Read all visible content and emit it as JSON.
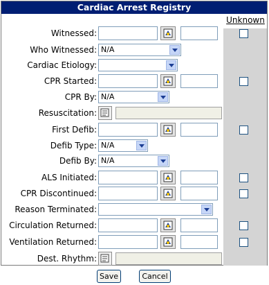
{
  "form": {
    "title": "Cardiac Arrest Registry",
    "unknown_header": "Unknown"
  },
  "fields": {
    "witnessed": {
      "label": "Witnessed:"
    },
    "who_witnessed": {
      "label": "Who Witnessed:",
      "value": "N/A"
    },
    "cardiac_etiology": {
      "label": "Cardiac Etiology:",
      "value": ""
    },
    "cpr_started": {
      "label": "CPR Started:"
    },
    "cpr_by": {
      "label": "CPR By:",
      "value": "N/A"
    },
    "resuscitation": {
      "label": "Resuscitation:"
    },
    "first_defib": {
      "label": "First Defib:"
    },
    "defib_type": {
      "label": "Defib Type:",
      "value": "N/A"
    },
    "defib_by": {
      "label": "Defib By:",
      "value": "N/A"
    },
    "als_initiated": {
      "label": "ALS Initiated:"
    },
    "cpr_discontinued": {
      "label": "CPR Discontinued:"
    },
    "reason_terminated": {
      "label": "Reason Terminated:",
      "value": ""
    },
    "circulation_returned": {
      "label": "Circulation Returned:"
    },
    "ventilation_returned": {
      "label": "Ventilation Returned:"
    },
    "dest_rhythm": {
      "label": "Dest. Rhythm:"
    }
  },
  "buttons": {
    "save": "Save",
    "cancel": "Cancel"
  },
  "icons": {
    "calendar": "calendar-clock-icon",
    "picker": "list-picker-icon"
  }
}
